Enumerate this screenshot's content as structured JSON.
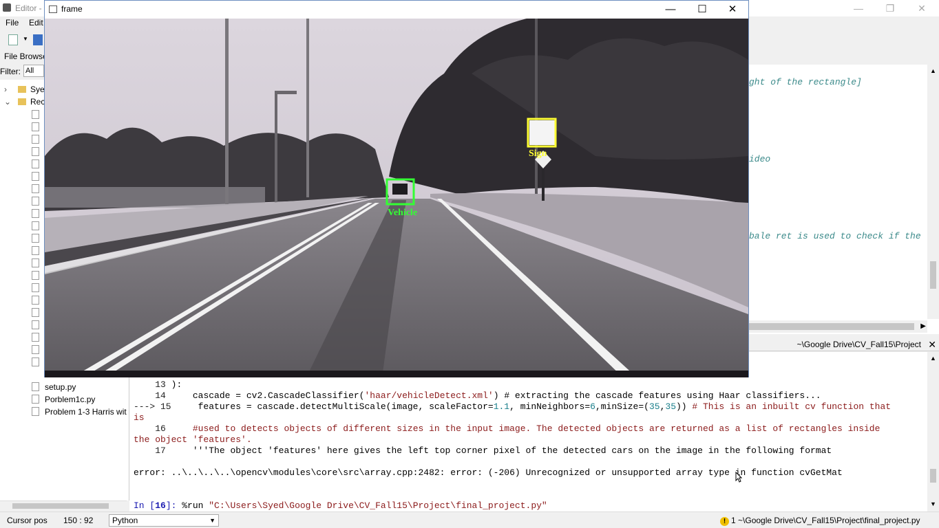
{
  "editor": {
    "title": "Editor -",
    "menu": [
      "File",
      "Edit"
    ],
    "file_browser_label": "File Browser",
    "filter_label": "Filter:",
    "filter_value": "All Su",
    "tree_folders": [
      "Sye",
      "Rec"
    ],
    "tree_files": [
      "setup.py",
      "Porblem1c.py",
      "Problem 1-3 Harris wit"
    ],
    "code_comments": [
      "ght of the rectangle]",
      "ideo",
      "bale ret is used to check if the"
    ],
    "console_tab_label": "~\\Google Drive\\CV_Fall15\\Project"
  },
  "frame": {
    "title": "frame",
    "detections": [
      {
        "label": "Vehicle",
        "color": "#33ff33"
      },
      {
        "label": "Sign",
        "color": "#ffff33"
      }
    ]
  },
  "console": {
    "line13": {
      "num": "13",
      "text": "):"
    },
    "line14": {
      "num": "14",
      "pre": "cascade = cv2.CascadeClassifier(",
      "str": "'haar/vehicleDetect.xml'",
      "cmt": ") # extracting the cascade features using Haar classifiers..."
    },
    "line15": {
      "arrow": "---> 15",
      "a": "features = cascade.detectMultiScale(image, scaleFactor=",
      "n1": "1.1",
      "b": ", minNeighbors=",
      "n2": "6",
      "c": ",minSize=(",
      "n3": "35",
      "d": ",",
      "n4": "35",
      "e": ")) ",
      "cmt": "# This is an inbuilt cv function that",
      "cmt2": "is"
    },
    "line16": {
      "num": "16",
      "cmt": "#used to detects objects of different sizes in the input image. The detected objects are returned as a list of rectangles inside",
      "cmt2": "the object 'features'."
    },
    "line17": {
      "num": "17",
      "text": "'''The object 'features' here gives the left top corner pixel of the detected cars on the image in the following format"
    },
    "error": "error: ..\\..\\..\\..\\opencv\\modules\\core\\src\\array.cpp:2482: error: (-206) Unrecognized or unsupported array type in function cvGetMat",
    "prompt": "In [",
    "prompt_num": "16",
    "prompt_end": "]: ",
    "command": "%run ",
    "command_path": "\"C:\\Users\\Syed\\Google Drive\\CV_Fall15\\Project\\final_project.py\""
  },
  "status": {
    "cursor_label": "Cursor pos",
    "cursor_value": "150 : 92",
    "language": "Python",
    "warn_count": "1",
    "file_path": "~\\Google Drive\\CV_Fall15\\Project\\final_project.py"
  }
}
